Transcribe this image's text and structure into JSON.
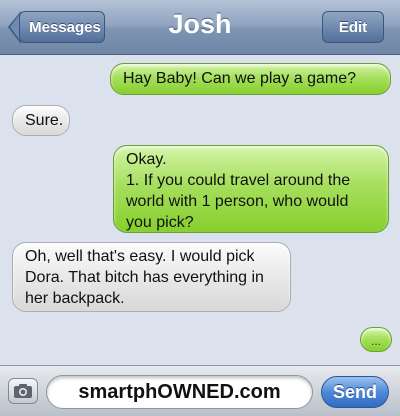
{
  "header": {
    "back_label": "Messages",
    "title": "Josh",
    "edit_label": "Edit"
  },
  "messages": [
    {
      "from": "me",
      "text": "Hay Baby! Can we play a game?"
    },
    {
      "from": "them",
      "text": "Sure."
    },
    {
      "from": "me",
      "text": "Okay.\n1. If you could travel around the world with 1 person, who would you pick?"
    },
    {
      "from": "them",
      "text": "Oh, well that's easy. I would pick Dora. That bitch has everything in her backpack."
    }
  ],
  "typing_indicator": {
    "text": "..."
  },
  "composer": {
    "camera_icon": "camera-icon",
    "field_text": "smartphOWNED.com",
    "send_label": "Send"
  },
  "colors": {
    "outgoing_bubble": "#a6df5e",
    "incoming_bubble": "#e7e7e7",
    "header": "#8ea3bf",
    "background": "#dbe2ed",
    "send_button": "#4f89d6"
  }
}
